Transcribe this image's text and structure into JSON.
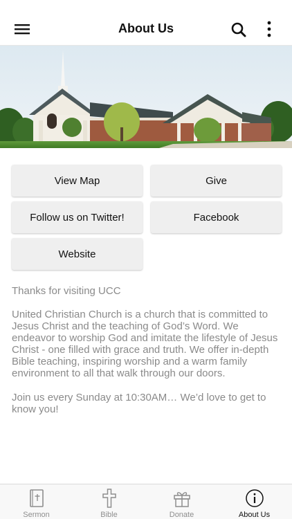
{
  "header": {
    "title": "About Us"
  },
  "actions": {
    "view_map": "View Map",
    "give": "Give",
    "twitter": "Follow us on Twitter!",
    "facebook": "Facebook",
    "website": "Website"
  },
  "about": {
    "greeting": "Thanks for visiting UCC",
    "description": "United Christian Church is a church that is committed to Jesus Christ and the teaching of God’s Word. We endeavor to worship God and imitate the lifestyle of Jesus Christ - one filled with grace and truth. We offer in-depth Bible teaching, inspiring worship and a warm family environment to all that walk through our doors.",
    "invite": "Join us every Sunday at 10:30AM… We’d love to get to know you!"
  },
  "tabs": [
    {
      "label": "Sermon",
      "icon": "book-icon"
    },
    {
      "label": "Bible",
      "icon": "cross-icon"
    },
    {
      "label": "Donate",
      "icon": "gift-icon"
    },
    {
      "label": "About Us",
      "icon": "info-icon",
      "active": true
    }
  ],
  "colors": {
    "text_muted": "#8a8a8a",
    "button_bg": "#efefef",
    "tab_active": "#111111",
    "tab_inactive": "#8e8e8e"
  }
}
